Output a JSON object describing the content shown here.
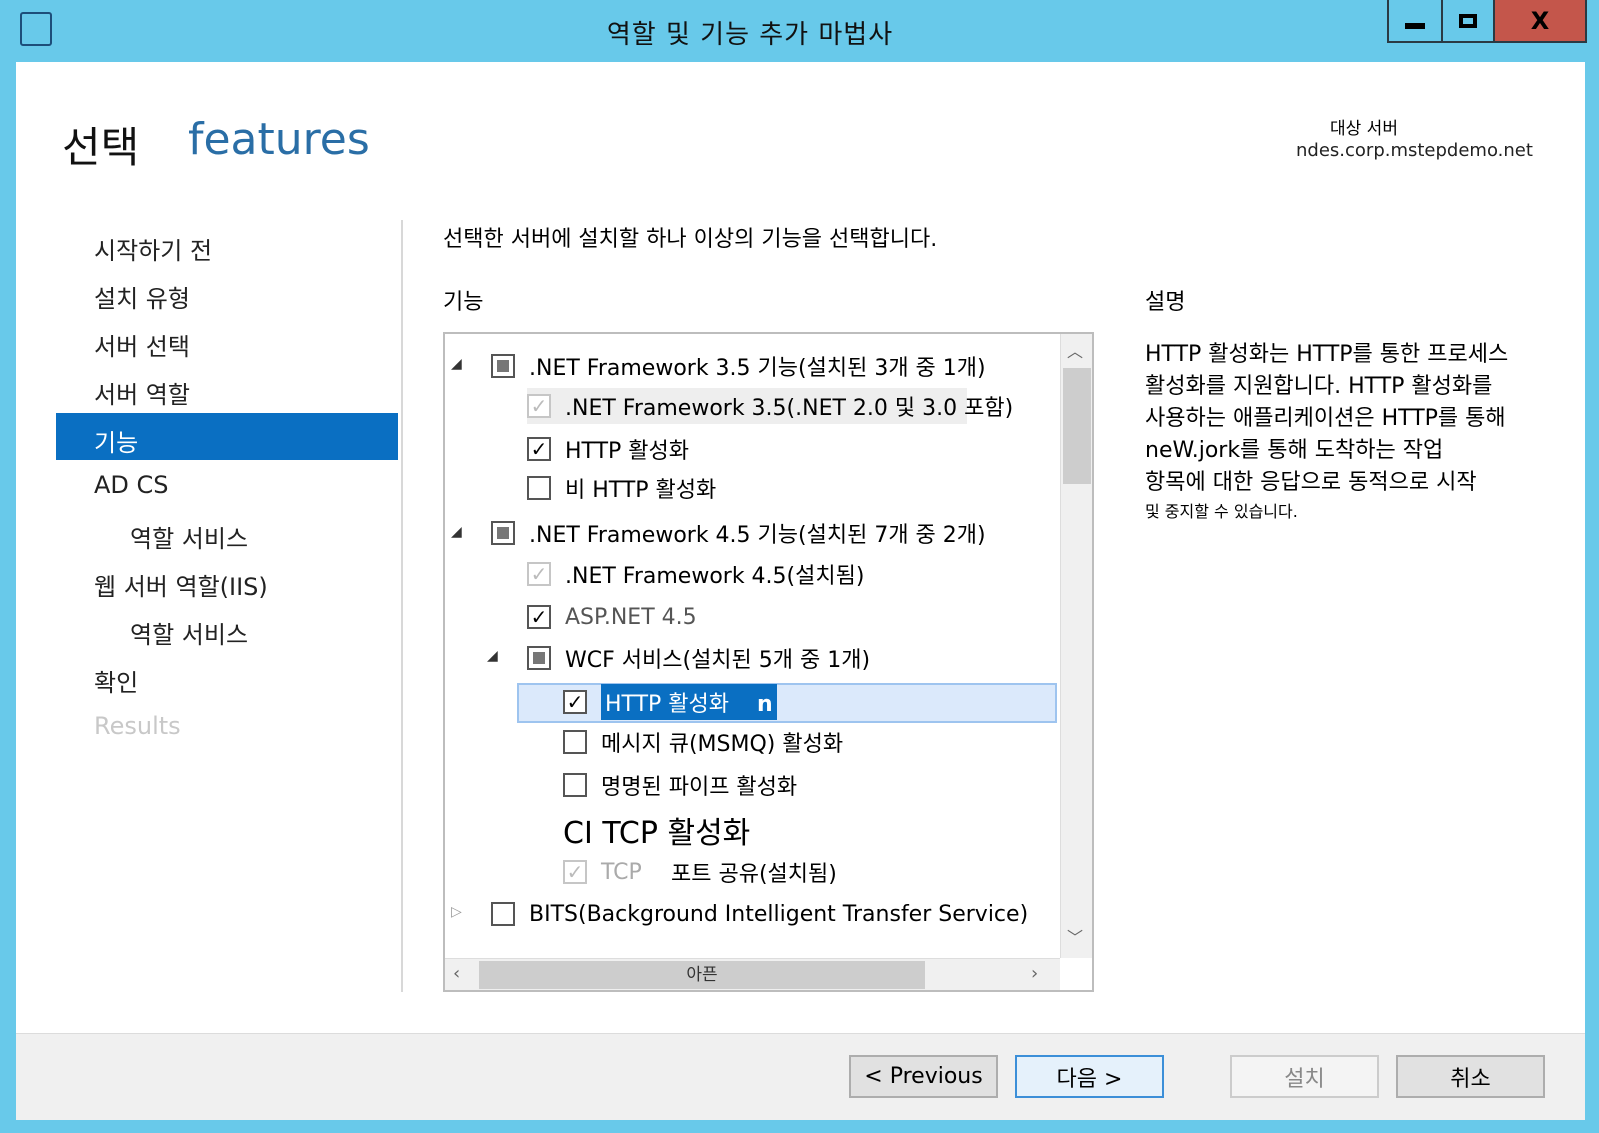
{
  "window": {
    "title": "역할 및 기능 추가 마법사",
    "minimize": "minimize",
    "maximize": "maximize",
    "close": "X",
    "close_color": "#c4564b",
    "frame_color": "#68c9ea"
  },
  "header": {
    "title": "선택",
    "subtitle": "features",
    "target_label": "대상 서버",
    "target_server": "ndes.corp.mstepdemo.net"
  },
  "nav": {
    "items": [
      {
        "label": "시작하기 전"
      },
      {
        "label": "설치 유형"
      },
      {
        "label": "서버 선택"
      },
      {
        "label": "서버 역할"
      },
      {
        "label": "기능",
        "selected": true
      },
      {
        "label": "AD CS"
      },
      {
        "label": "역할 서비스"
      },
      {
        "label": "웹 서버 역할(IIS)"
      },
      {
        "label": "역할 서비스"
      },
      {
        "label": "확인"
      },
      {
        "label": "Results",
        "disabled": true
      }
    ],
    "accent": "#0a6fc2"
  },
  "main": {
    "instruction": "선택한 서버에 설치할 하나 이상의 기능을 선택합니다.",
    "features_label": "기능",
    "tree": [
      {
        "label": ".NET Framework 3.5 기능(설치된 3개 중 1개)",
        "state": "partial",
        "expanded": true
      },
      {
        "label": ".NET Framework 3.5(.NET 2.0 및 3.0 포함)",
        "state": "checked-disabled"
      },
      {
        "label": "HTTP 활성화",
        "state": "checked"
      },
      {
        "label": "비 HTTP 활성화",
        "state": "unchecked"
      },
      {
        "label": ".NET Framework 4.5 기능(설치된 7개 중 2개)",
        "state": "partial",
        "expanded": true
      },
      {
        "label": ".NET Framework 4.5(설치됨)",
        "state": "checked-disabled"
      },
      {
        "label": "ASP.NET 4.5",
        "state": "checked"
      },
      {
        "label": "WCF 서비스(설치된 5개 중 1개)",
        "state": "partial",
        "expanded": true
      },
      {
        "label": "HTTP 활성화",
        "state": "checked",
        "selected": true,
        "suffix": "n"
      },
      {
        "label": "메시지 큐(MSMQ) 활성화",
        "state": "unchecked"
      },
      {
        "label": "명명된 파이프 활성화",
        "state": "unchecked"
      },
      {
        "label": "CI TCP 활성화"
      },
      {
        "label": "TCP",
        "label2": "포트 공유(설치됨)",
        "state": "checked-disabled"
      },
      {
        "label": "BITS(Background Intelligent Transfer Service)",
        "state": "unchecked",
        "expanded": false
      }
    ],
    "hscroll_label": "아픈"
  },
  "description": {
    "label": "설명",
    "lines": [
      "HTTP 활성화는 HTTP를 통한 프로세스",
      "활성화를 지원합니다. HTTP 활성화를",
      "사용하는 애플리케이션은 HTTP를 통해",
      "neW.jork를 통해 도착하는 작업",
      "항목에 대한 응답으로 동적으로 시작",
      "및 중지할 수 있습니다."
    ]
  },
  "footer": {
    "previous": "< Previous",
    "next": "다음 >",
    "install": "설치",
    "cancel": "취소"
  }
}
